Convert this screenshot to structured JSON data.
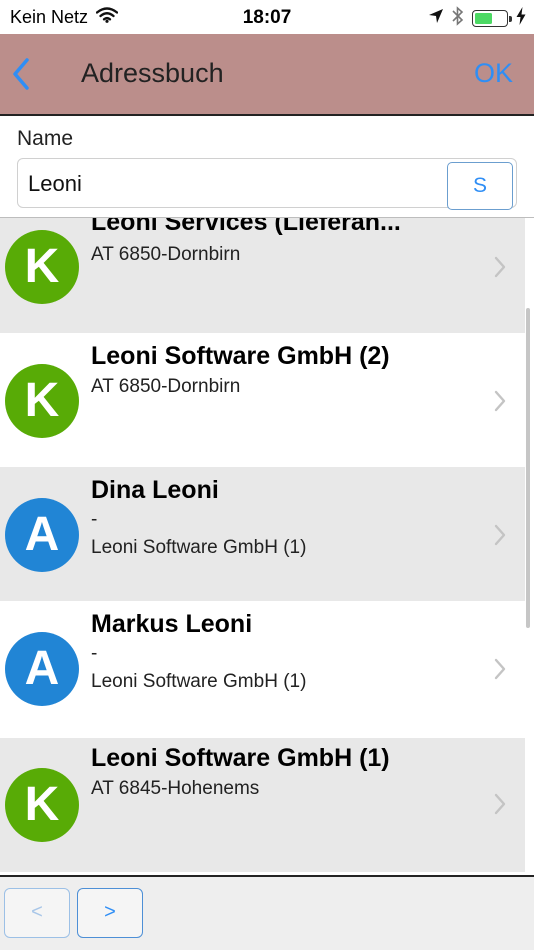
{
  "status_bar": {
    "carrier": "Kein Netz",
    "time": "18:07",
    "battery_level": 0.55,
    "icons": [
      "wifi-icon",
      "location-arrow-icon",
      "bluetooth-icon",
      "battery-icon",
      "charging-bolt-icon"
    ]
  },
  "nav": {
    "back_icon": "chevron-left-icon",
    "title": "Adressbuch",
    "ok_label": "OK"
  },
  "search": {
    "label": "Name",
    "value": "Leoni",
    "button_label": "S"
  },
  "results": [
    {
      "avatar_letter": "K",
      "avatar_color": "#58ab06",
      "title": "Leoni Services (Lieferan...",
      "lines": [
        "AT 6850-Dornbirn"
      ],
      "partially_scrolled": true
    },
    {
      "avatar_letter": "K",
      "avatar_color": "#58ab06",
      "title": "Leoni Software  GmbH (2)",
      "lines": [
        "AT 6850-Dornbirn"
      ]
    },
    {
      "avatar_letter": "A",
      "avatar_color": "#2185d5",
      "title": "Dina Leoni",
      "lines": [
        "-",
        "Leoni Software GmbH (1)"
      ]
    },
    {
      "avatar_letter": "A",
      "avatar_color": "#2185d5",
      "title": "Markus Leoni",
      "lines": [
        "-",
        "Leoni Software GmbH (1)"
      ]
    },
    {
      "avatar_letter": "K",
      "avatar_color": "#58ab06",
      "title": "Leoni Software GmbH (1)",
      "lines": [
        "AT 6845-Hohenems"
      ]
    }
  ],
  "pager": {
    "prev_label": "<",
    "next_label": ">"
  },
  "colors": {
    "nav_background": "#bb8e8b",
    "accent": "#2f8ef5",
    "row_alt_background": "#e8e8e8",
    "company_avatar": "#58ab06",
    "person_avatar": "#2185d5"
  }
}
